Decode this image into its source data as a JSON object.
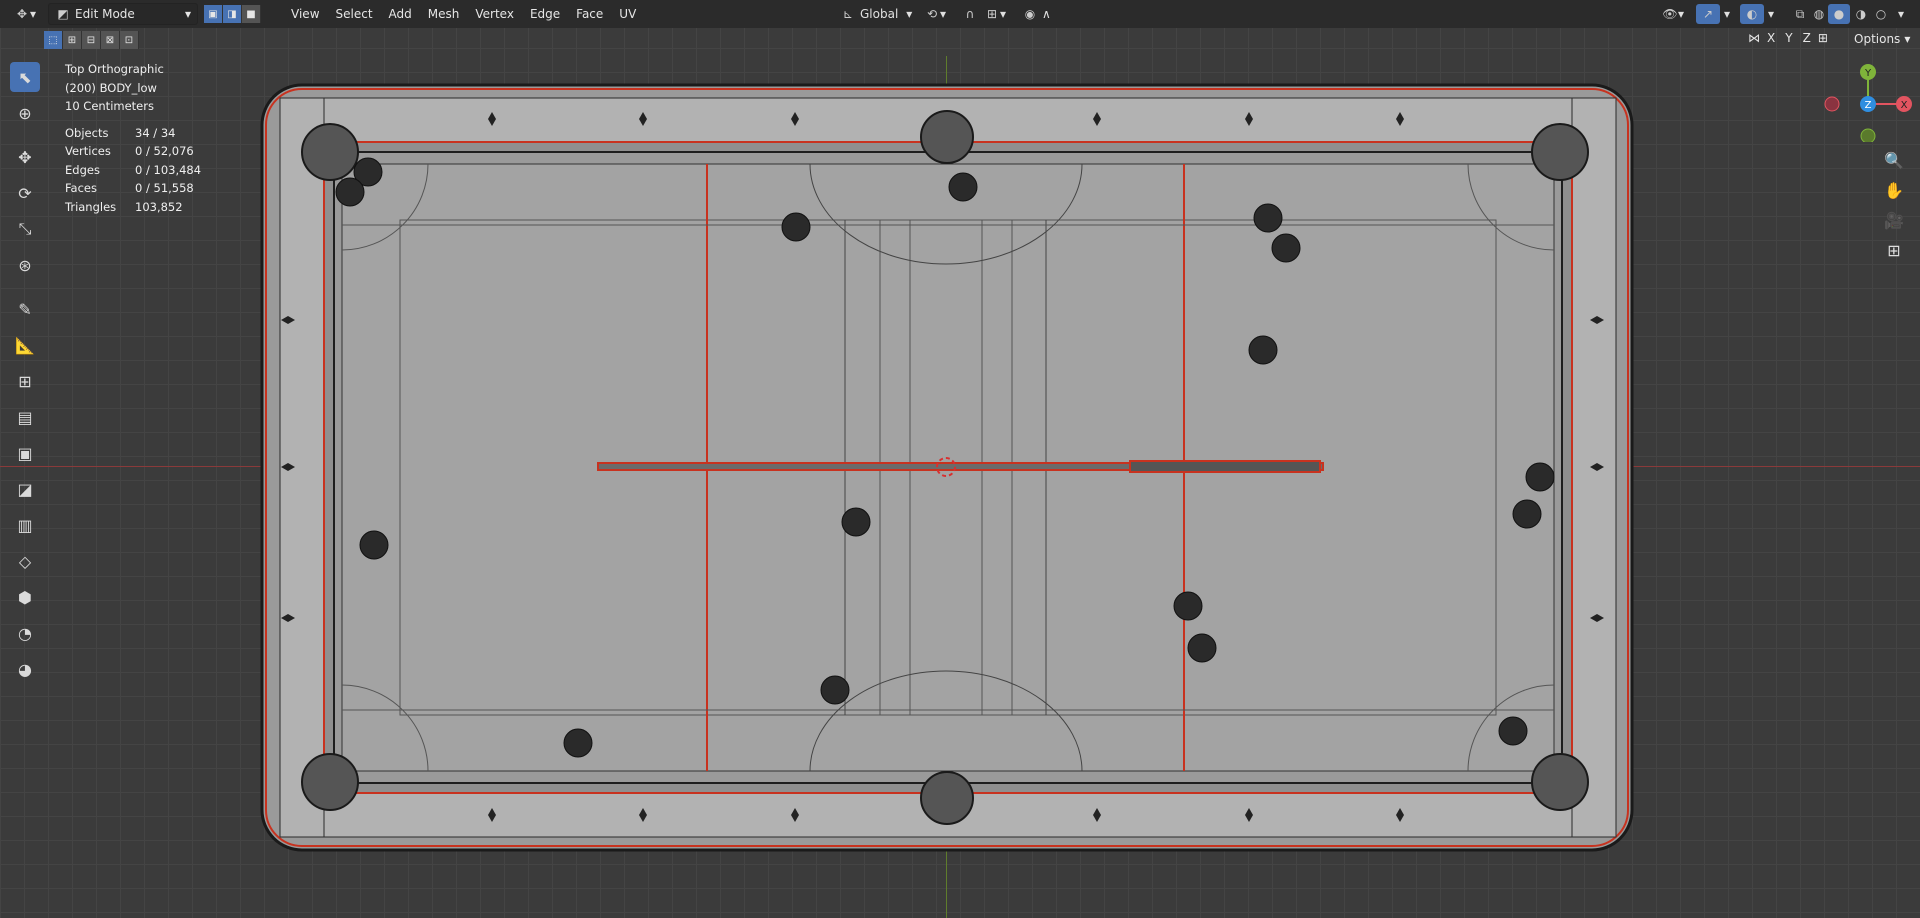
{
  "header": {
    "mode": "Edit Mode",
    "menus": [
      "View",
      "Select",
      "Add",
      "Mesh",
      "Vertex",
      "Edge",
      "Face",
      "UV"
    ],
    "orientation": "Global",
    "axis_lock": [
      "X",
      "Y",
      "Z"
    ],
    "options_label": "Options"
  },
  "overlay_info": {
    "view_name": "Top Orthographic",
    "object_name": "(200) BODY_low",
    "grid_scale": "10 Centimeters",
    "stats": [
      {
        "label": "Objects",
        "value": "34 / 34"
      },
      {
        "label": "Vertices",
        "value": "0 / 52,076"
      },
      {
        "label": "Edges",
        "value": "0 / 103,484"
      },
      {
        "label": "Faces",
        "value": "0 / 51,558"
      },
      {
        "label": "Triangles",
        "value": "103,852"
      }
    ]
  },
  "gizmo": {
    "x": "X",
    "y": "Y",
    "z": "Z"
  },
  "colors": {
    "accent": "#4772b3",
    "header": "#2b2b2b",
    "table": "#a2a2a2",
    "edge_seam": "#d0321e"
  },
  "icons": {
    "tools": [
      "select-box-icon",
      "cursor-icon",
      "move-icon",
      "rotate-icon",
      "scale-icon",
      "transform-icon",
      "annotate-icon",
      "measure-icon",
      "add-cube-icon",
      "extrude-icon",
      "inset-icon",
      "bevel-icon",
      "loop-cut-icon",
      "knife-icon",
      "poly-build-icon",
      "spin-icon",
      "smooth-icon",
      "edge-slide-icon",
      "shrink-fatten-icon",
      "shear-icon",
      "rip-icon"
    ],
    "nav": [
      "zoom-icon",
      "hand-icon",
      "camera-icon",
      "grid-icon"
    ]
  }
}
